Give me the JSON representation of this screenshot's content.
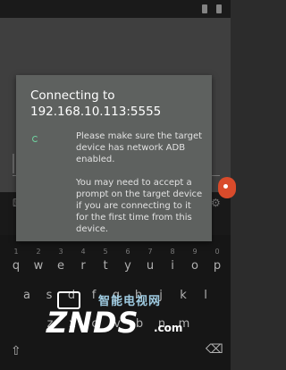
{
  "dialog": {
    "title": "Connecting to\n192.168.10.113:5555",
    "message": "Please make sure the target device has network ADB enabled.\n\nYou may need to accept a prompt on the target device if you are connecting to it for the first time from this device."
  },
  "keyboard": {
    "row1_numbers": [
      "1",
      "2",
      "3",
      "4",
      "5",
      "6",
      "7",
      "8",
      "9",
      "0"
    ],
    "row1_letters": [
      "q",
      "w",
      "e",
      "r",
      "t",
      "y",
      "u",
      "i",
      "o",
      "p"
    ],
    "row2_letters": [
      "a",
      "s",
      "d",
      "f",
      "g",
      "h",
      "j",
      "k",
      "l"
    ],
    "row3_letters": [
      "z",
      "x",
      "c",
      "v",
      "b",
      "n",
      "m"
    ]
  },
  "watermark": {
    "chinese_text": "智能电视网",
    "logo_text": "ZNDS",
    "domain_suffix": ".com"
  },
  "colors": {
    "dialog_bg": "#5e615f",
    "app_bg": "#4a4a4a",
    "keyboard_bg": "#1a1a1a",
    "spinner": "#6fd3a0",
    "side_bubble": "#d94b2b"
  },
  "icons": {
    "keyboard_settings": "gear-icon",
    "shift": "shift-icon",
    "backspace": "backspace-icon"
  }
}
